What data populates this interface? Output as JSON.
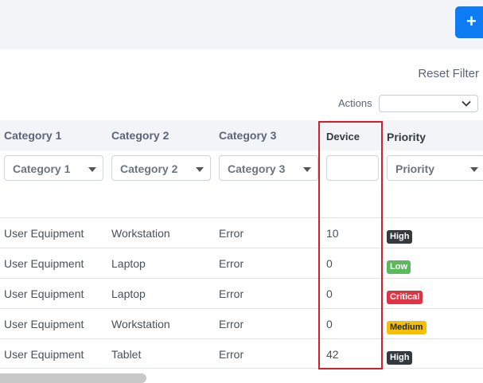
{
  "toolbar": {
    "add_icon": "plus-icon",
    "accent": "#0d7cf2"
  },
  "filters": {
    "reset_label": "Reset Filter",
    "actions_label": "Actions",
    "actions_value": ""
  },
  "columns": [
    {
      "title": "Category 1",
      "placeholder": "Category 1"
    },
    {
      "title": "Category 2",
      "placeholder": "Category 2"
    },
    {
      "title": "Category 3",
      "placeholder": "Category 3"
    },
    {
      "title": "Device",
      "placeholder": ""
    },
    {
      "title": "Priority",
      "placeholder": "Priority"
    }
  ],
  "rows": [
    {
      "cat1": "User Equipment",
      "cat2": "Workstation",
      "cat3": "Error",
      "device": "10",
      "priority": "High",
      "priority_color": "#343a40",
      "priority_text": "#ffffff"
    },
    {
      "cat1": "User Equipment",
      "cat2": "Laptop",
      "cat3": "Error",
      "device": "0",
      "priority": "Low",
      "priority_color": "#5cb85c",
      "priority_text": "#ffffff"
    },
    {
      "cat1": "User Equipment",
      "cat2": "Laptop",
      "cat3": "Error",
      "device": "0",
      "priority": "Critical",
      "priority_color": "#dc3545",
      "priority_text": "#ffffff"
    },
    {
      "cat1": "User Equipment",
      "cat2": "Workstation",
      "cat3": "Error",
      "device": "0",
      "priority": "Medium",
      "priority_color": "#f5c000",
      "priority_text": "#212529"
    },
    {
      "cat1": "User Equipment",
      "cat2": "Tablet",
      "cat3": "Error",
      "device": "42",
      "priority": "High",
      "priority_color": "#343a40",
      "priority_text": "#ffffff"
    }
  ]
}
